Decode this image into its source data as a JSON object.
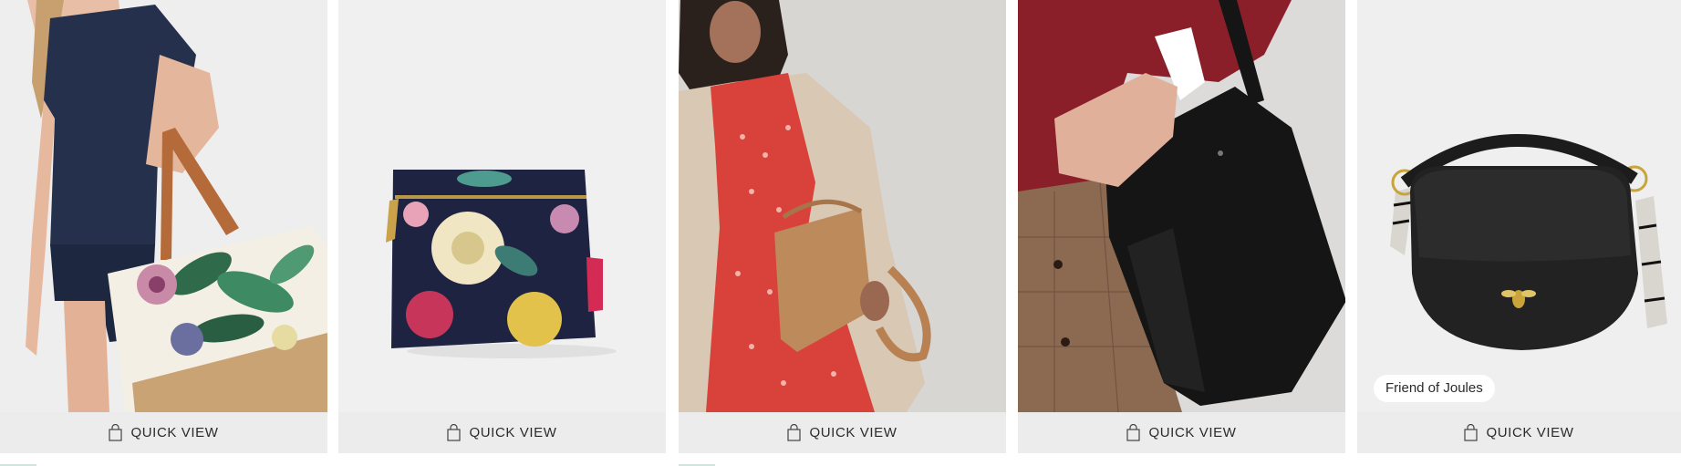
{
  "products": [
    {
      "id": "tote",
      "quick_view": "QUICK VIEW"
    },
    {
      "id": "pouch",
      "quick_view": "QUICK VIEW"
    },
    {
      "id": "tan-bag",
      "quick_view": "QUICK VIEW"
    },
    {
      "id": "black-bucket",
      "quick_view": "QUICK VIEW"
    },
    {
      "id": "saddle-bag",
      "quick_view": "QUICK VIEW",
      "badge": "Friend of Joules"
    }
  ],
  "colors": {
    "quick_view_bg": "#ececec",
    "photo_bg": "#f0f0f0",
    "text": "#2b2b2b"
  },
  "icons": {
    "quick_view": "shopping-bag-icon"
  }
}
